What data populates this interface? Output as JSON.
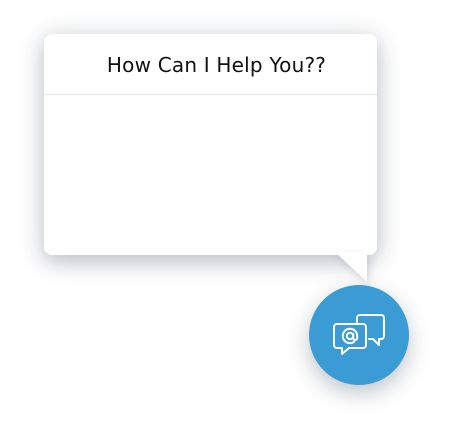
{
  "chat_popup": {
    "title": "How Can I Help You??",
    "body_text": ""
  },
  "launcher": {
    "icon": "email-chat-bubbles-icon",
    "background_color": "#3b9bd4",
    "icon_color": "#ffffff"
  }
}
